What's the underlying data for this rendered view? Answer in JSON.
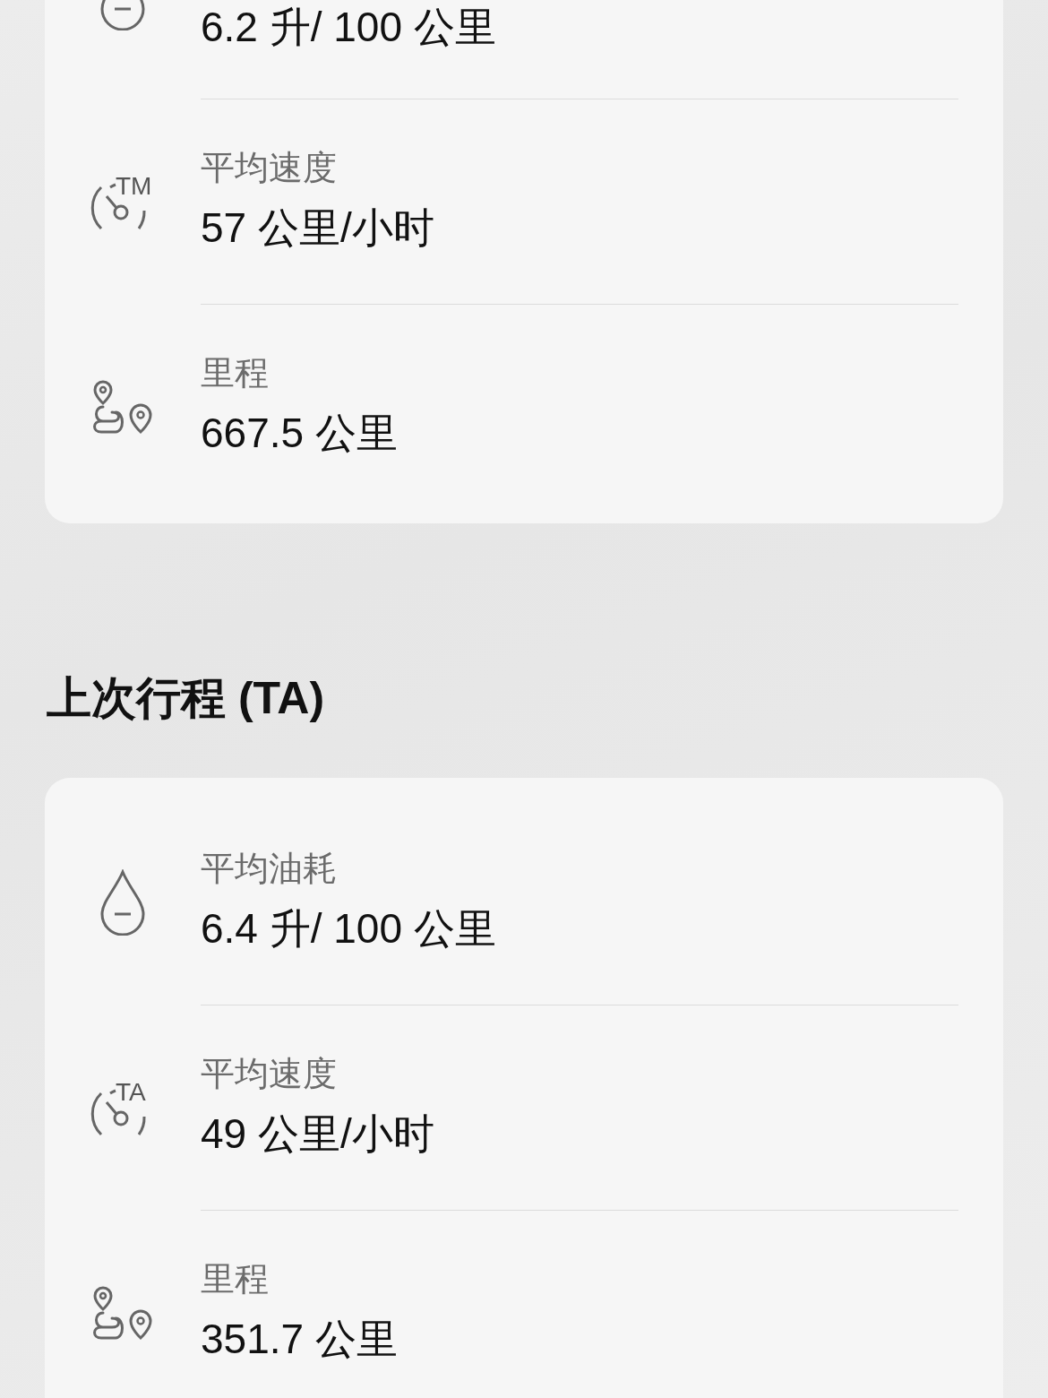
{
  "current_trip": {
    "rows": [
      {
        "kind": "fuel",
        "value": "6.2 升/ 100 公里"
      },
      {
        "kind": "speed",
        "badge": "TM",
        "label": "平均速度",
        "value": "57 公里/小时"
      },
      {
        "kind": "distance",
        "label": "里程",
        "value": "667.5 公里"
      }
    ]
  },
  "last_trip": {
    "title": "上次行程 (TA)",
    "rows": [
      {
        "kind": "fuel",
        "label": "平均油耗",
        "value": "6.4 升/ 100 公里"
      },
      {
        "kind": "speed",
        "badge": "TA",
        "label": "平均速度",
        "value": "49 公里/小时"
      },
      {
        "kind": "distance",
        "label": "里程",
        "value": "351.7 公里"
      }
    ]
  }
}
